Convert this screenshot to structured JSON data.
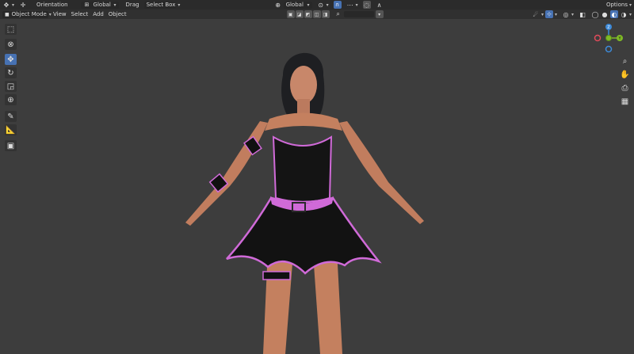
{
  "header": {
    "orientation_label": "Orientation",
    "orientation_value": "Global",
    "drag_label": "Drag",
    "drag_value": "Select Box",
    "transform_orientation": "Global",
    "options_label": "Options"
  },
  "viewport_header": {
    "mode": "Object Mode",
    "menus": [
      "View",
      "Select",
      "Add",
      "Object"
    ]
  },
  "gizmo": {
    "z_label": "Z",
    "y_label": "Y",
    "x_label": "X"
  },
  "colors": {
    "accent": "#4772b3",
    "x_axis": "#e04b5a",
    "y_axis": "#7fba26",
    "z_axis": "#3d8ad9",
    "outfit": "#111111",
    "trim": "#d06ad8"
  }
}
